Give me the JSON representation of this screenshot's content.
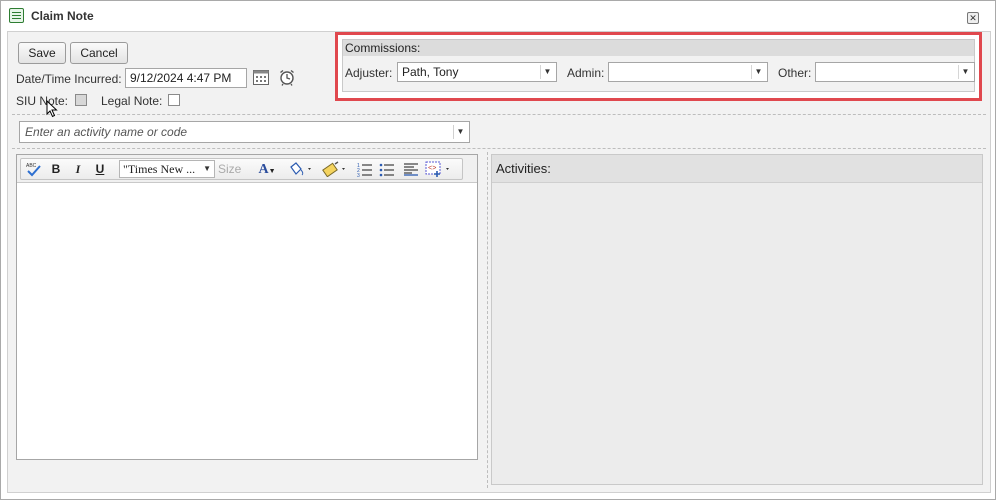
{
  "window": {
    "title": "Claim Note",
    "close_icon": "close-icon"
  },
  "toolbar": {
    "save_label": "Save",
    "cancel_label": "Cancel"
  },
  "incurred": {
    "label": "Date/Time Incurred:",
    "value": "9/12/2024 4:47 PM"
  },
  "siu_note": {
    "label": "SIU Note:",
    "checked": true
  },
  "legal_note": {
    "label": "Legal Note:",
    "checked": false
  },
  "commissions": {
    "header": "Commissions:",
    "adjuster_label": "Adjuster:",
    "adjuster_value": "Path, Tony",
    "admin_label": "Admin:",
    "admin_value": "",
    "other_label": "Other:",
    "other_value": ""
  },
  "activity": {
    "placeholder": "Enter an activity name or code"
  },
  "editor": {
    "font_name": "\"Times New ...",
    "size_label": "Size",
    "bold": "B",
    "italic": "I",
    "underline": "U",
    "font_color_glyph": "A"
  },
  "activities": {
    "header": "Activities:"
  },
  "colors": {
    "highlight_border": "#e0484e",
    "panel_bg": "#f2f2f2"
  }
}
